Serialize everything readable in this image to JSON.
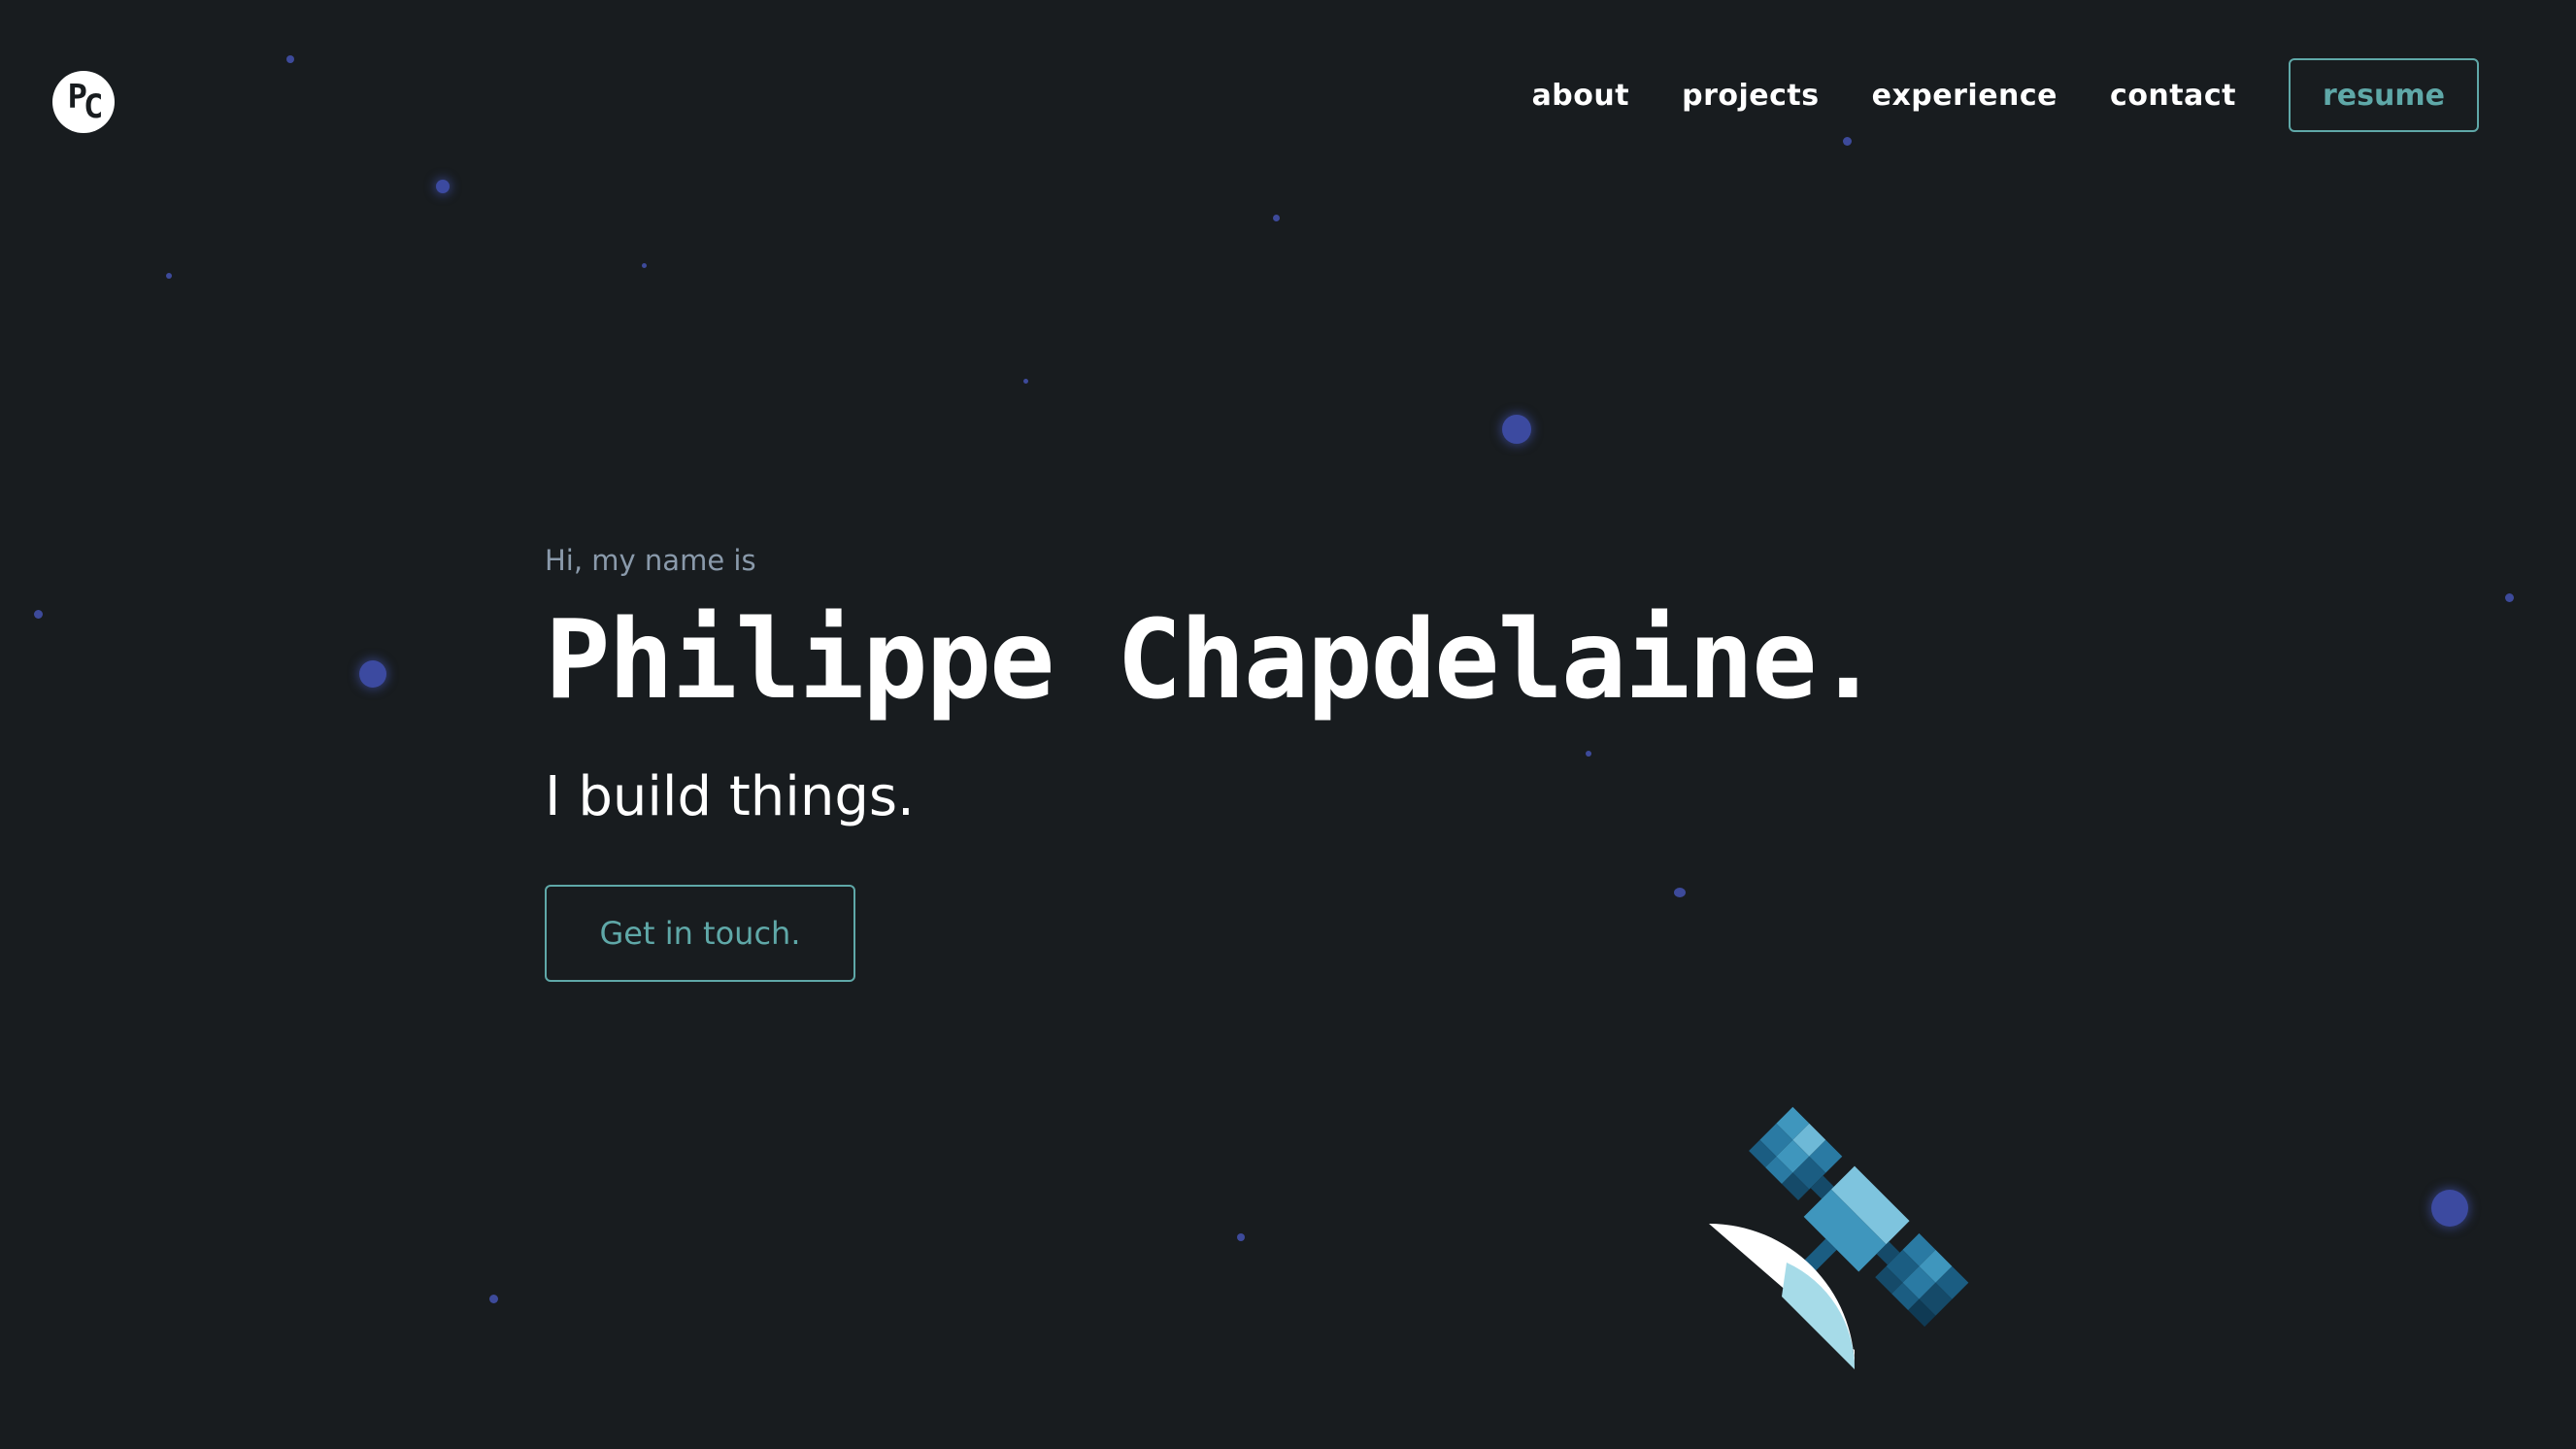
{
  "header": {
    "logo_text_1": "P",
    "logo_text_2": "C",
    "nav": [
      {
        "label": "about"
      },
      {
        "label": "projects"
      },
      {
        "label": "experience"
      },
      {
        "label": "contact"
      }
    ],
    "resume_label": "resume"
  },
  "hero": {
    "intro": "Hi, my name is",
    "name": "Philippe Chapdelaine.",
    "tagline": "I build things.",
    "cta_label": "Get in touch."
  },
  "decor": {
    "satellite_icon": "satellite-icon",
    "star_color": "#3d4a9a"
  },
  "colors": {
    "background": "#181c1f",
    "accent": "#5fa8a8",
    "text": "#ffffff",
    "muted": "#8a9aab"
  }
}
